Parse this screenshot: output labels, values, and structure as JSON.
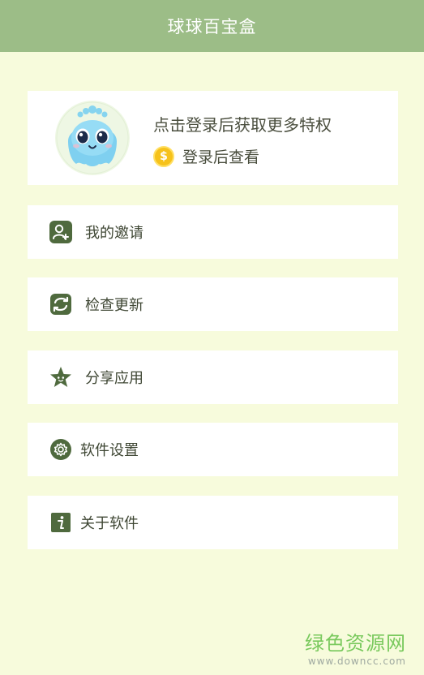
{
  "app": {
    "title": "球球百宝盒"
  },
  "profile": {
    "headline": "点击登录后获取更多特权",
    "coin_label": "登录后查看",
    "coin_symbol": "$"
  },
  "menu": [
    {
      "icon": "user-add-icon",
      "label": "我的邀请"
    },
    {
      "icon": "refresh-icon",
      "label": "检查更新"
    },
    {
      "icon": "star-icon",
      "label": "分享应用"
    },
    {
      "icon": "gear-icon",
      "label": "软件设置"
    },
    {
      "icon": "info-icon",
      "label": "关于软件"
    }
  ],
  "watermark": {
    "name": "绿色资源网",
    "url": "www.downcc.com"
  },
  "colors": {
    "header": "#9cbd87",
    "background": "#f7fbdc",
    "icon": "#4f6a3e",
    "coin": "#f6c21b"
  }
}
